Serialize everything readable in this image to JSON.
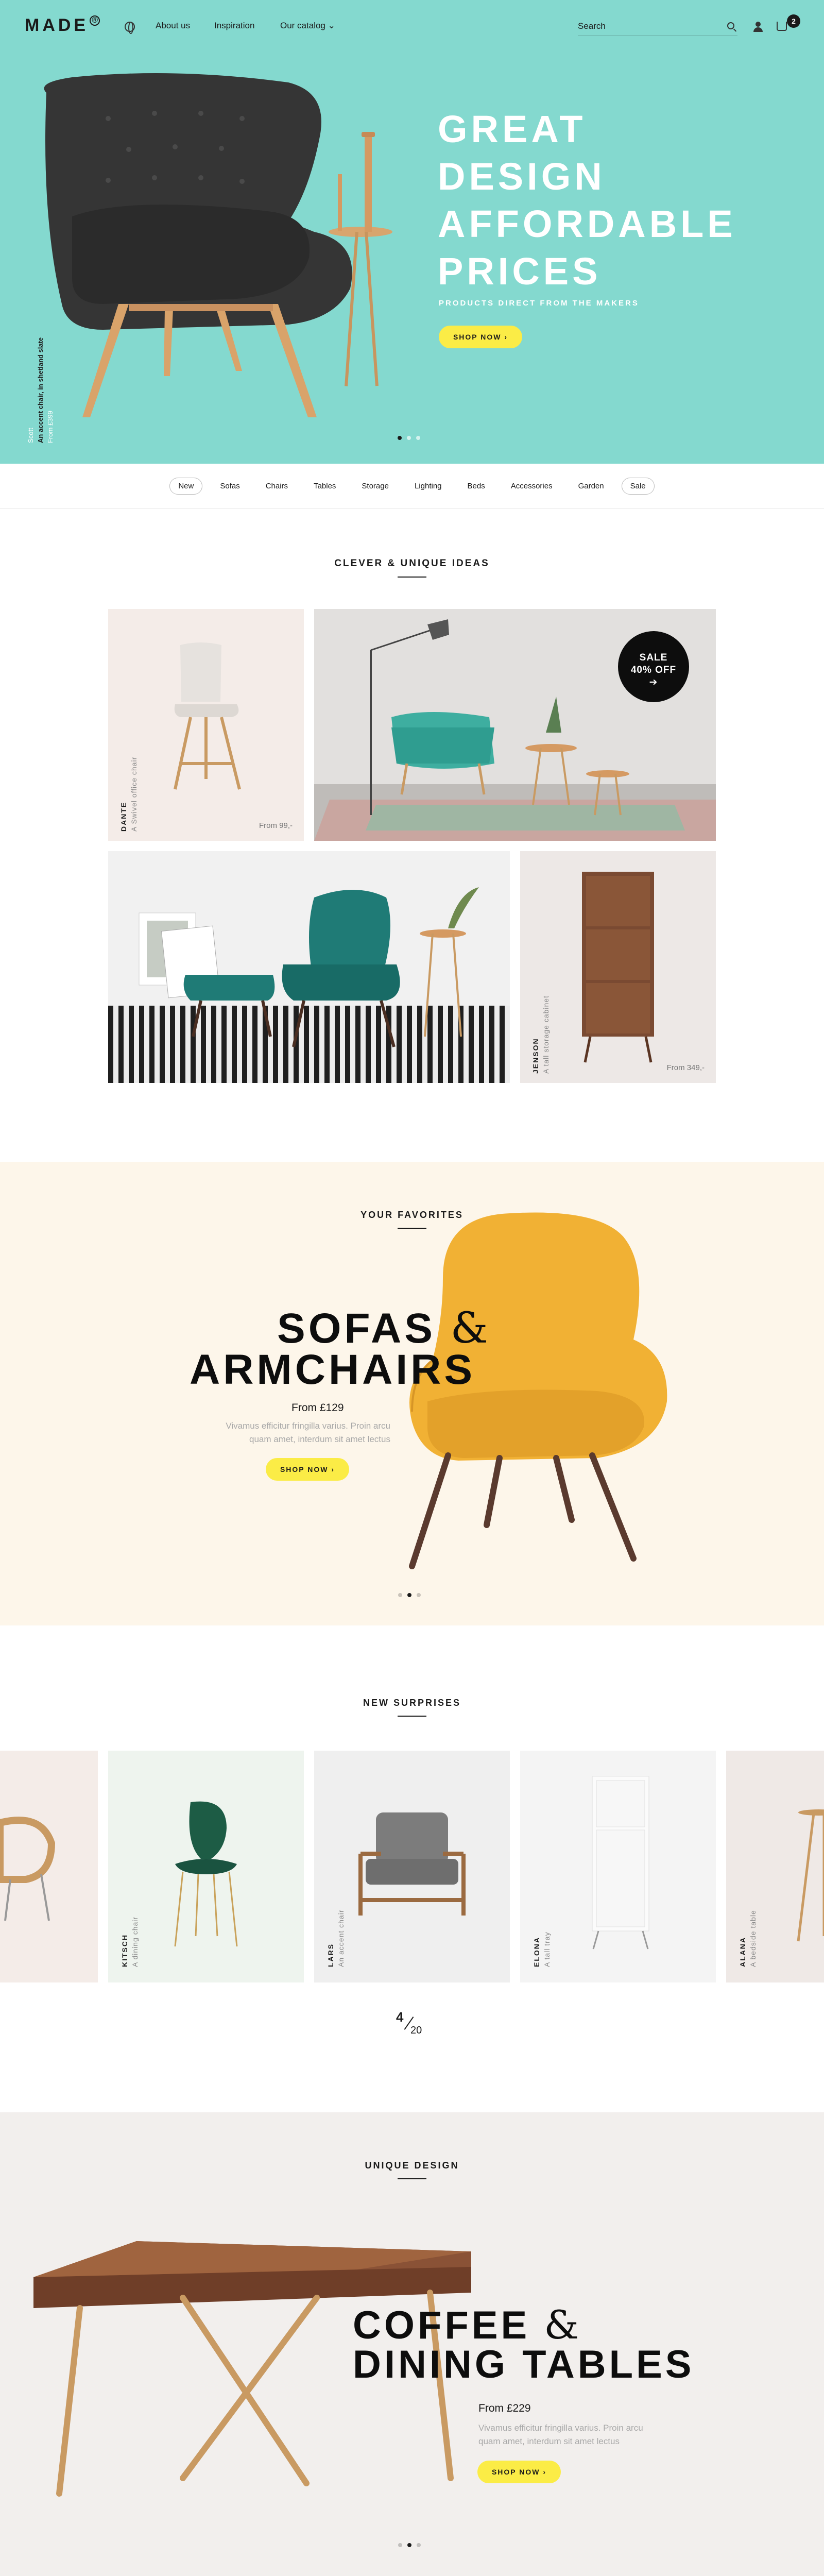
{
  "nav": {
    "logo": "MADE",
    "logo_mark": "®",
    "links": [
      "About us",
      "Inspiration",
      "Our catalog ⌄"
    ],
    "search_placeholder": "Search",
    "cart_count": "2"
  },
  "hero": {
    "title_lines": [
      "GREAT",
      "DESIGN",
      "AFFORDABLE",
      "PRICES"
    ],
    "subtitle": "PRODUCTS DIRECT FROM THE MAKERS",
    "button": "SHOP NOW ›",
    "caption": {
      "name": "Scott",
      "desc": "An accent chair, in shetland slate",
      "price": "From £399"
    },
    "slide_count": 3,
    "active_slide": 0
  },
  "categories": [
    "New",
    "Sofas",
    "Chairs",
    "Tables",
    "Storage",
    "Lighting",
    "Beds",
    "Accessories",
    "Garden",
    "Sale"
  ],
  "clever": {
    "title": "CLEVER & UNIQUE IDEAS",
    "tile1": {
      "name": "DANTE",
      "desc": "A Swivel office chair",
      "price": "From 99,-"
    },
    "sale": {
      "line1": "SALE",
      "line2": "40% OFF",
      "arrow": "➔"
    },
    "tile4": {
      "name": "JENSON",
      "desc": "A tall storage cabinet",
      "price": "From 349,-"
    }
  },
  "favorites": {
    "eyebrow": "YOUR FAVORITES",
    "title1": "SOFAS",
    "amp": "&",
    "title2": "ARMCHAIRS",
    "price": "From £129",
    "text1": "Vivamus efficitur fringilla varius. Proin arcu",
    "text2": "quam amet, interdum sit amet lectus",
    "button": "SHOP NOW ›",
    "slide_count": 3,
    "active_slide": 1
  },
  "surprises": {
    "title": "NEW SURPRISES",
    "items": [
      {
        "name": "KITSCH",
        "desc": "A dining chair"
      },
      {
        "name": "LARS",
        "desc": "An accent chair"
      },
      {
        "name": "ELONA",
        "desc": "A tall tray"
      },
      {
        "name": "ALANA",
        "desc": "A bedside table"
      }
    ],
    "counter_current": "4",
    "counter_total": "20"
  },
  "unique": {
    "eyebrow": "UNIQUE DESIGN",
    "title1": "COFFEE",
    "amp": "&",
    "title2": "DINING TABLES",
    "price": "From £229",
    "text1": "Vivamus efficitur fringilla varius. Proin arcu",
    "text2": "quam amet, interdum sit amet lectus",
    "button": "SHOP NOW ›",
    "slide_count": 3,
    "active_slide": 1
  },
  "colors": {
    "teal": "#84d9cf",
    "yellow": "#fbec46",
    "cream": "#fdf6ea",
    "stone": "#f2efed"
  }
}
